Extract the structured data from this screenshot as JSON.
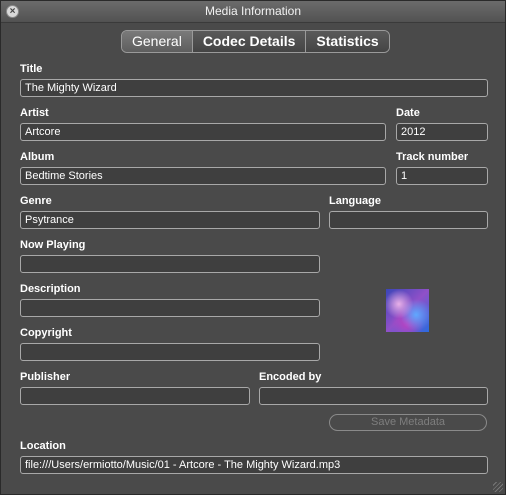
{
  "window": {
    "title": "Media Information"
  },
  "tabs": [
    {
      "label": "General"
    },
    {
      "label": "Codec Details"
    },
    {
      "label": "Statistics"
    }
  ],
  "fields": {
    "title": {
      "label": "Title",
      "value": "The Mighty Wizard"
    },
    "artist": {
      "label": "Artist",
      "value": "Artcore"
    },
    "date": {
      "label": "Date",
      "value": "2012"
    },
    "album": {
      "label": "Album",
      "value": "Bedtime Stories"
    },
    "track_number": {
      "label": "Track number",
      "value": "1"
    },
    "genre": {
      "label": "Genre",
      "value": "Psytrance"
    },
    "language": {
      "label": "Language",
      "value": ""
    },
    "now_playing": {
      "label": "Now Playing",
      "value": ""
    },
    "description": {
      "label": "Description",
      "value": ""
    },
    "copyright": {
      "label": "Copyright",
      "value": ""
    },
    "publisher": {
      "label": "Publisher",
      "value": ""
    },
    "encoded_by": {
      "label": "Encoded by",
      "value": ""
    },
    "location": {
      "label": "Location",
      "value": "file:///Users/ermiotto/Music/01 - Artcore - The Mighty Wizard.mp3"
    }
  },
  "buttons": {
    "save_metadata": "Save Metadata"
  }
}
